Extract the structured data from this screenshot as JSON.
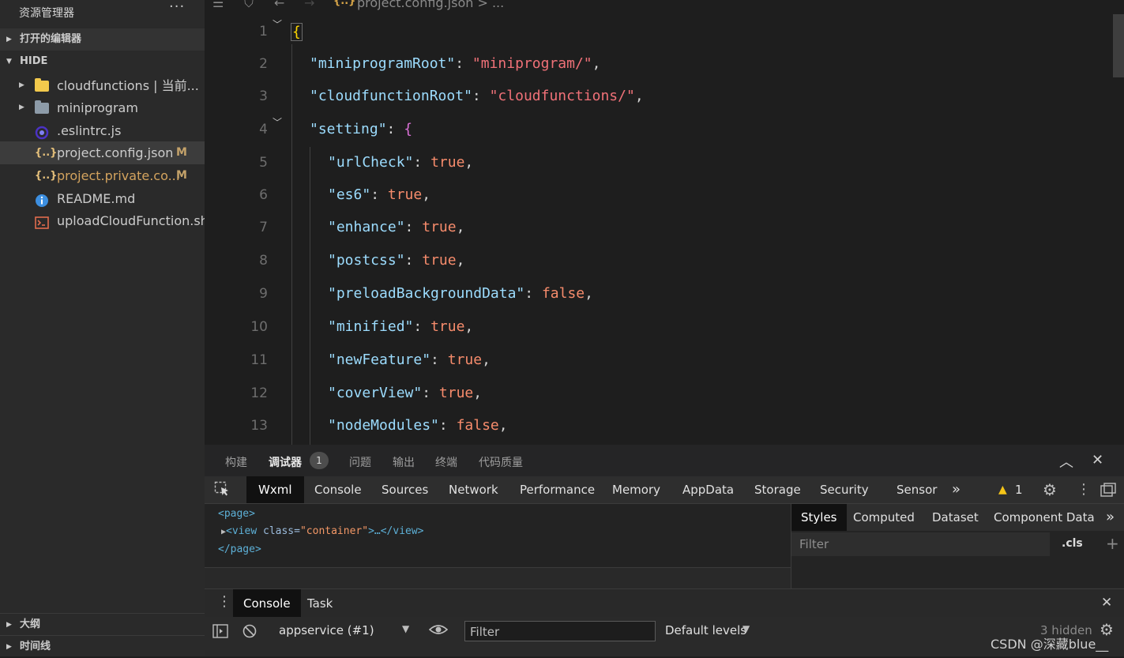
{
  "sidebar": {
    "title": "资源管理器",
    "more": "···",
    "open_editors": "打开的编辑器",
    "project": "HIDE",
    "files": [
      {
        "name": "cloudfunctions | 当前...",
        "icon": "folder-icon",
        "badge": ""
      },
      {
        "name": "miniprogram",
        "icon": "folder-icon",
        "badge": ""
      },
      {
        "name": ".eslintrc.js",
        "icon": "eslint-icon",
        "badge": ""
      },
      {
        "name": "project.config.json",
        "icon": "json-icon",
        "badge": "M"
      },
      {
        "name": "project.private.co...",
        "icon": "json-icon",
        "badge": "M"
      },
      {
        "name": "README.md",
        "icon": "info-icon",
        "badge": ""
      },
      {
        "name": "uploadCloudFunction.sh",
        "icon": "terminal-icon",
        "badge": ""
      }
    ],
    "outline": "大纲",
    "timeline": "时间线"
  },
  "editor": {
    "breadcrumb_icon": "{..}",
    "breadcrumb": "project.config.json > ...",
    "line_numbers": [
      "1",
      "2",
      "3",
      "4",
      "5",
      "6",
      "7",
      "8",
      "9",
      "10",
      "11",
      "12",
      "13"
    ]
  },
  "code": {
    "l1": "{",
    "l2_key": "\"miniprogramRoot\"",
    "l2_val": "\"miniprogram/\"",
    "l3_key": "\"cloudfunctionRoot\"",
    "l3_val": "\"cloudfunctions/\"",
    "l4_key": "\"setting\"",
    "l4_brace": "{",
    "l5_key": "\"urlCheck\"",
    "l5_val": "true",
    "l6_key": "\"es6\"",
    "l6_val": "true",
    "l7_key": "\"enhance\"",
    "l7_val": "true",
    "l8_key": "\"postcss\"",
    "l8_val": "true",
    "l9_key": "\"preloadBackgroundData\"",
    "l9_val": "false",
    "l10_key": "\"minified\"",
    "l10_val": "true",
    "l11_key": "\"newFeature\"",
    "l11_val": "true",
    "l12_key": "\"coverView\"",
    "l12_val": "true",
    "l13_key": "\"nodeModules\"",
    "l13_val": "false",
    "colon": ": ",
    "comma": ","
  },
  "panel": {
    "tabs": [
      "构建",
      "调试器",
      "问题",
      "输出",
      "终端",
      "代码质量"
    ],
    "debugger_count": "1",
    "devtools_tabs": [
      "Wxml",
      "Console",
      "Sources",
      "Network",
      "Performance",
      "Memory",
      "AppData",
      "Storage",
      "Security",
      "Sensor"
    ],
    "more": "»",
    "warning_count": "1",
    "wxml": {
      "page_open": "<page>",
      "view_tag_open": "<view ",
      "class_attr": "class=",
      "class_val": "\"container\"",
      "view_rest": ">…</view>",
      "page_close": "</page>"
    },
    "styles_tabs": [
      "Styles",
      "Computed",
      "Dataset",
      "Component Data"
    ],
    "styles_filter_placeholder": "Filter",
    "cls": ".cls",
    "console_tabs": [
      "Console",
      "Task"
    ],
    "context": "appservice (#1)",
    "console_filter_placeholder": "Filter",
    "levels": "Default levels",
    "hidden": "3 hidden"
  },
  "watermark": "CSDN @深藏blue__"
}
